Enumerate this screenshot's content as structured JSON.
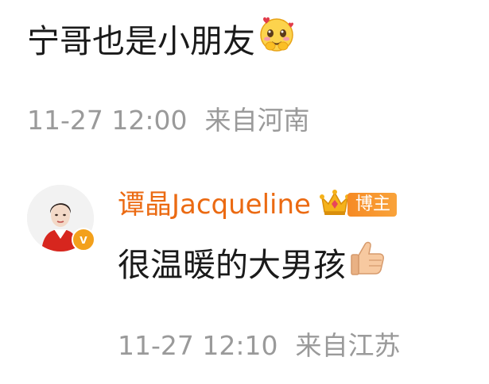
{
  "comment": {
    "text": "宁哥也是小朋友",
    "emoji": "blushing-heart-face-emoji",
    "time": "11-27 12:00",
    "location": "来自河南"
  },
  "reply": {
    "username": "谭晶Jacqueline",
    "badge_label": "博主",
    "badge_icon": "crown-icon",
    "verified_icon": "v-verified-icon",
    "text": "很温暖的大男孩",
    "emoji": "thumbs-up-emoji",
    "time": "11-27 12:10",
    "location": "来自江苏"
  },
  "colors": {
    "username": "#eb6a12",
    "meta": "#9a9a9a",
    "badge": "#f68a24",
    "verified": "#f3a01b"
  }
}
